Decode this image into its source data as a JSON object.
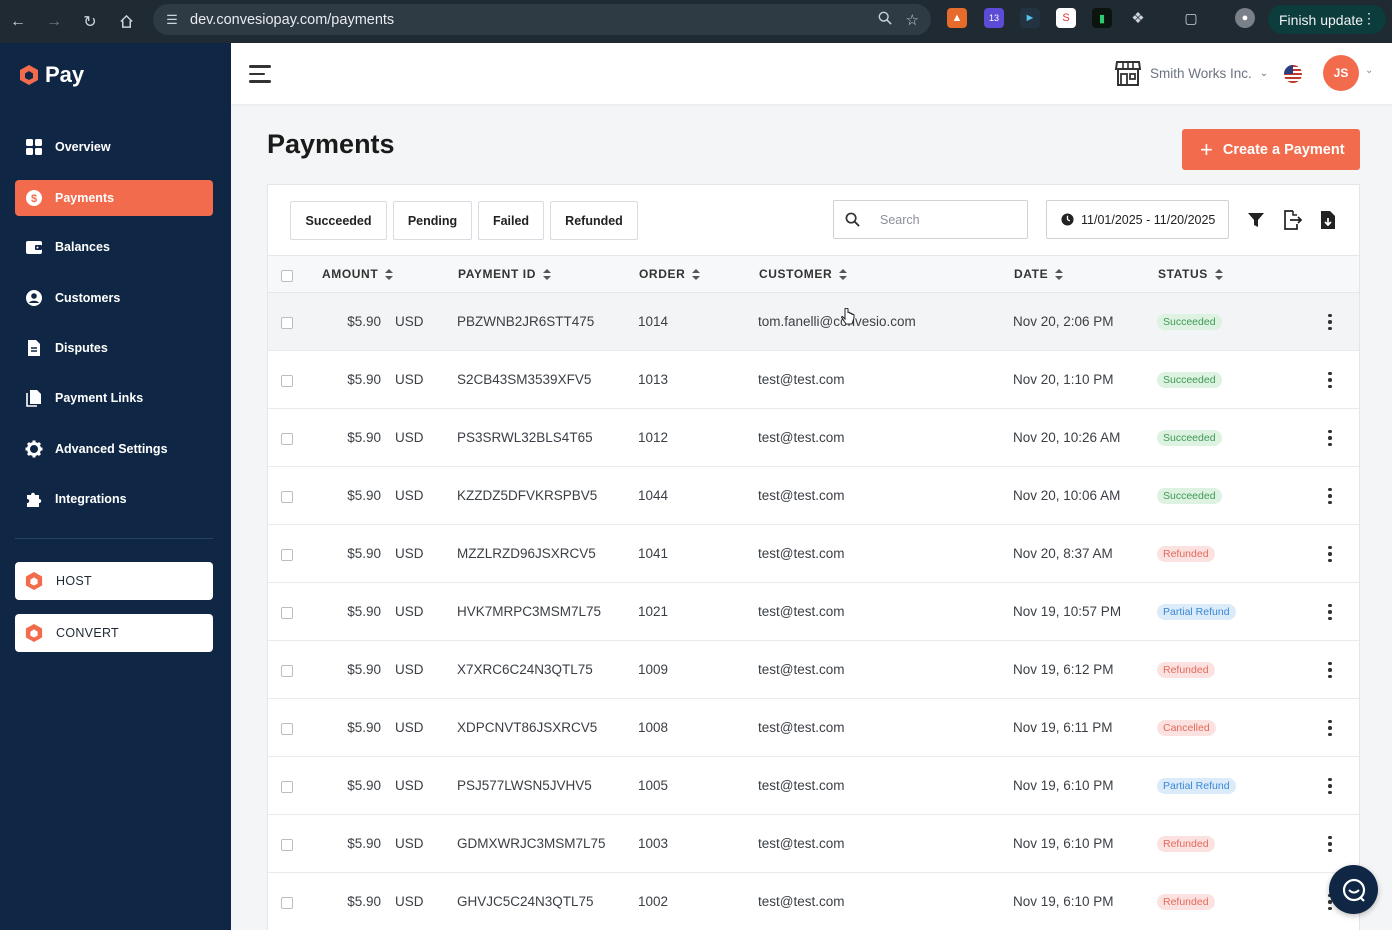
{
  "browser": {
    "url": "dev.convesiopay.com/payments",
    "finish_update_label": "Finish update",
    "extension_badge": "13"
  },
  "sidebar": {
    "logo_text": "Pay",
    "items": [
      {
        "label": "Overview",
        "icon": "grid-icon",
        "active": false
      },
      {
        "label": "Payments",
        "icon": "dollar-icon",
        "active": true
      },
      {
        "label": "Balances",
        "icon": "wallet-icon",
        "active": false
      },
      {
        "label": "Customers",
        "icon": "user-circle-icon",
        "active": false
      },
      {
        "label": "Disputes",
        "icon": "document-icon",
        "active": false
      },
      {
        "label": "Payment Links",
        "icon": "files-icon",
        "active": false
      },
      {
        "label": "Advanced Settings",
        "icon": "gear-icon",
        "active": false
      },
      {
        "label": "Integrations",
        "icon": "puzzle-icon",
        "active": false
      }
    ],
    "products": [
      {
        "label": "HOST",
        "icon": "convesio-logo-icon"
      },
      {
        "label": "CONVERT",
        "icon": "convesio-logo-icon"
      }
    ]
  },
  "topbar": {
    "company_name": "Smith Works Inc.",
    "avatar_initials": "JS"
  },
  "page": {
    "title": "Payments",
    "create_button_label": "Create a Payment"
  },
  "filters": {
    "tabs": [
      "Succeeded",
      "Pending",
      "Failed",
      "Refunded"
    ],
    "search_placeholder": "Search",
    "date_range": "11/01/2025 - 11/20/2025"
  },
  "table": {
    "columns": [
      "AMOUNT",
      "PAYMENT ID",
      "ORDER",
      "CUSTOMER",
      "DATE",
      "STATUS"
    ],
    "rows": [
      {
        "amount": "$5.90",
        "currency": "USD",
        "payment_id": "PBZWNB2JR6STT475",
        "order": "1014",
        "customer": "tom.fanelli@convesio.com",
        "date": "Nov 20, 2:06 PM",
        "status": "Succeeded",
        "status_type": "succeeded"
      },
      {
        "amount": "$5.90",
        "currency": "USD",
        "payment_id": "S2CB43SM3539XFV5",
        "order": "1013",
        "customer": "test@test.com",
        "date": "Nov 20, 1:10 PM",
        "status": "Succeeded",
        "status_type": "succeeded"
      },
      {
        "amount": "$5.90",
        "currency": "USD",
        "payment_id": "PS3SRWL32BLS4T65",
        "order": "1012",
        "customer": "test@test.com",
        "date": "Nov 20, 10:26 AM",
        "status": "Succeeded",
        "status_type": "succeeded"
      },
      {
        "amount": "$5.90",
        "currency": "USD",
        "payment_id": "KZZDZ5DFVKRSPBV5",
        "order": "1044",
        "customer": "test@test.com",
        "date": "Nov 20, 10:06 AM",
        "status": "Succeeded",
        "status_type": "succeeded"
      },
      {
        "amount": "$5.90",
        "currency": "USD",
        "payment_id": "MZZLRZD96JSXRCV5",
        "order": "1041",
        "customer": "test@test.com",
        "date": "Nov 20, 8:37 AM",
        "status": "Refunded",
        "status_type": "refunded"
      },
      {
        "amount": "$5.90",
        "currency": "USD",
        "payment_id": "HVK7MRPC3MSM7L75",
        "order": "1021",
        "customer": "test@test.com",
        "date": "Nov 19, 10:57 PM",
        "status": "Partial Refund",
        "status_type": "partial"
      },
      {
        "amount": "$5.90",
        "currency": "USD",
        "payment_id": "X7XRC6C24N3QTL75",
        "order": "1009",
        "customer": "test@test.com",
        "date": "Nov 19, 6:12 PM",
        "status": "Refunded",
        "status_type": "refunded"
      },
      {
        "amount": "$5.90",
        "currency": "USD",
        "payment_id": "XDPCNVT86JSXRCV5",
        "order": "1008",
        "customer": "test@test.com",
        "date": "Nov 19, 6:11 PM",
        "status": "Cancelled",
        "status_type": "cancelled"
      },
      {
        "amount": "$5.90",
        "currency": "USD",
        "payment_id": "PSJ577LWSN5JVHV5",
        "order": "1005",
        "customer": "test@test.com",
        "date": "Nov 19, 6:10 PM",
        "status": "Partial Refund",
        "status_type": "partial"
      },
      {
        "amount": "$5.90",
        "currency": "USD",
        "payment_id": "GDMXWRJC3MSM7L75",
        "order": "1003",
        "customer": "test@test.com",
        "date": "Nov 19, 6:10 PM",
        "status": "Refunded",
        "status_type": "refunded"
      },
      {
        "amount": "$5.90",
        "currency": "USD",
        "payment_id": "GHVJC5C24N3QTL75",
        "order": "1002",
        "customer": "test@test.com",
        "date": "Nov 19, 6:10 PM",
        "status": "Refunded",
        "status_type": "refunded"
      }
    ]
  },
  "colors": {
    "sidebar_bg": "#0f2744",
    "accent": "#f26b4d",
    "succeeded": "#3f9a55",
    "refunded": "#e36a5b",
    "partial_refund": "#3b88d3"
  }
}
